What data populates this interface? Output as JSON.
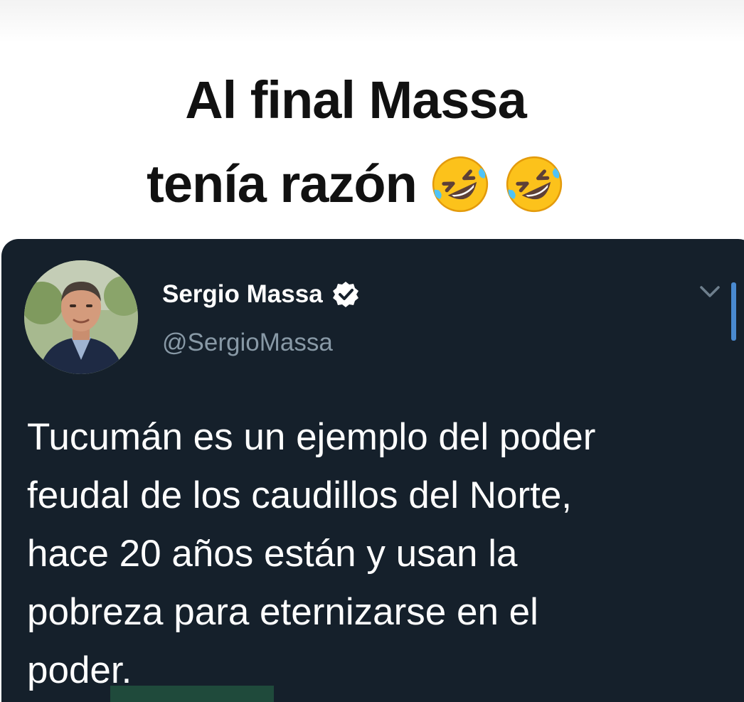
{
  "caption": {
    "line1": "Al final Massa",
    "line2": "tenía razón",
    "emoji": "rolling-on-the-floor-laughing"
  },
  "tweet": {
    "display_name": "Sergio Massa",
    "verified": true,
    "handle": "@SergioMassa",
    "text": "Tucumán es un ejemplo del poder\nfeudal de los caudillos del Norte,\nhace 20 años están y usan la\npobreza para eternizarse en el\npoder.",
    "colors": {
      "background": "#15202b",
      "handle": "#8899a6",
      "text": "#ffffff",
      "accent": "#4a8ad0"
    }
  }
}
